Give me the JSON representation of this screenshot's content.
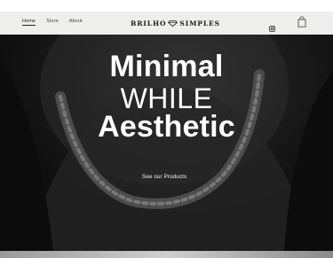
{
  "nav": {
    "items": [
      {
        "label": "Home",
        "active": true
      },
      {
        "label": "Store",
        "active": false
      },
      {
        "label": "About",
        "active": false
      }
    ]
  },
  "brand": {
    "left": "BRILHO",
    "right": "SIMPLES",
    "logo_icon": "gem-icon"
  },
  "header_icons": {
    "instagram": "instagram-icon",
    "cart": "shopping-bag-icon"
  },
  "hero": {
    "line1": "Minimal",
    "line2": "WHILE",
    "line3": "Aesthetic",
    "cta_label": "See our Products"
  },
  "colors": {
    "header_bg": "#eeeeec",
    "hero_bg": "#1a1a1a",
    "headline": "#ffffff",
    "cta_bg": "#262626"
  }
}
